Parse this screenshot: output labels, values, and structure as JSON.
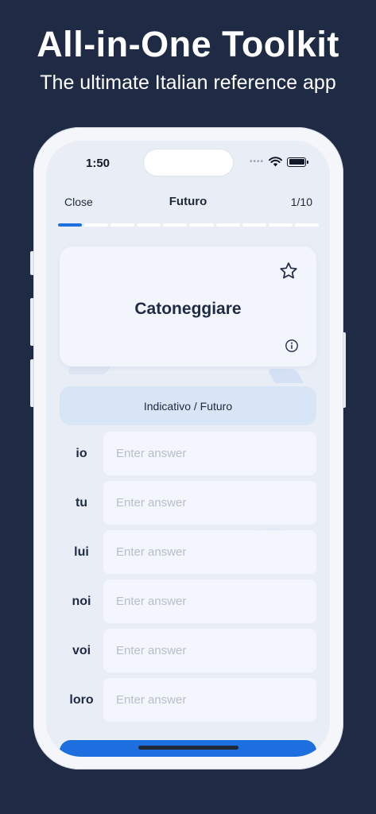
{
  "promo": {
    "headline": "All-in-One Toolkit",
    "subhead": "The ultimate Italian reference app"
  },
  "status_bar": {
    "time": "1:50",
    "icons": [
      "signal-icon",
      "wifi-icon",
      "battery-icon"
    ]
  },
  "nav": {
    "close_label": "Close",
    "title": "Futuro",
    "counter": "1/10"
  },
  "progress": {
    "current": 1,
    "total": 10
  },
  "card": {
    "word": "Catoneggiare",
    "icons": [
      "star-icon",
      "info-icon"
    ]
  },
  "tense_label": "Indicativo / Futuro",
  "answer_placeholder": "Enter answer",
  "pronouns": [
    "io",
    "tu",
    "lui",
    "noi",
    "voi",
    "loro"
  ],
  "colors": {
    "background": "#1f2a45",
    "accent": "#1d6fe0",
    "screen": "#e8edf6"
  }
}
